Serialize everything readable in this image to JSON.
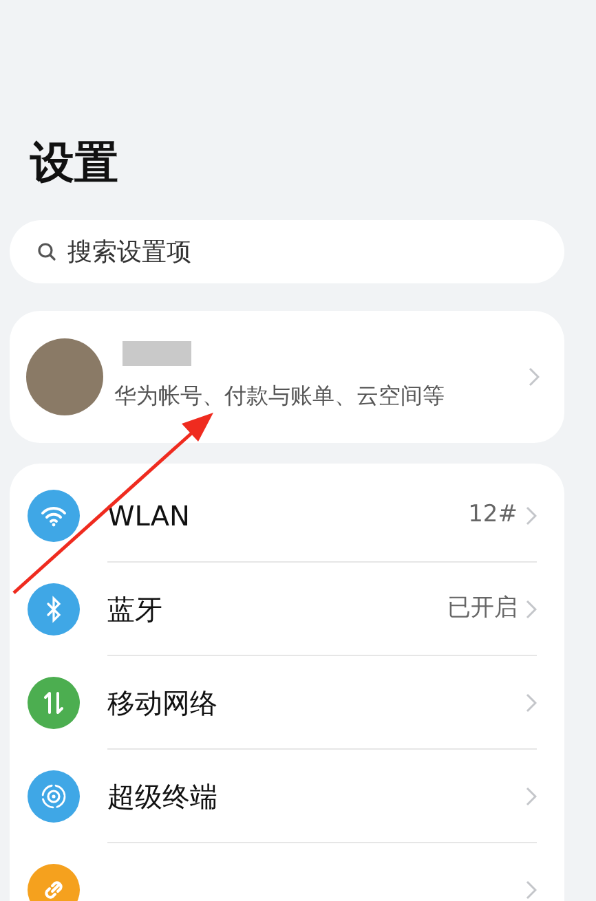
{
  "title": "设置",
  "search": {
    "placeholder": "搜索设置项"
  },
  "account": {
    "subtitle": "华为帐号、付款与账单、云空间等"
  },
  "items": [
    {
      "label": "WLAN",
      "value": "12#",
      "color": "#3fa7e6"
    },
    {
      "label": "蓝牙",
      "value": "已开启",
      "color": "#3fa7e6"
    },
    {
      "label": "移动网络",
      "color": "#4cae50"
    },
    {
      "label": "超级终端",
      "color": "#3fa7e6"
    },
    {
      "color": "#f5a11e"
    }
  ]
}
